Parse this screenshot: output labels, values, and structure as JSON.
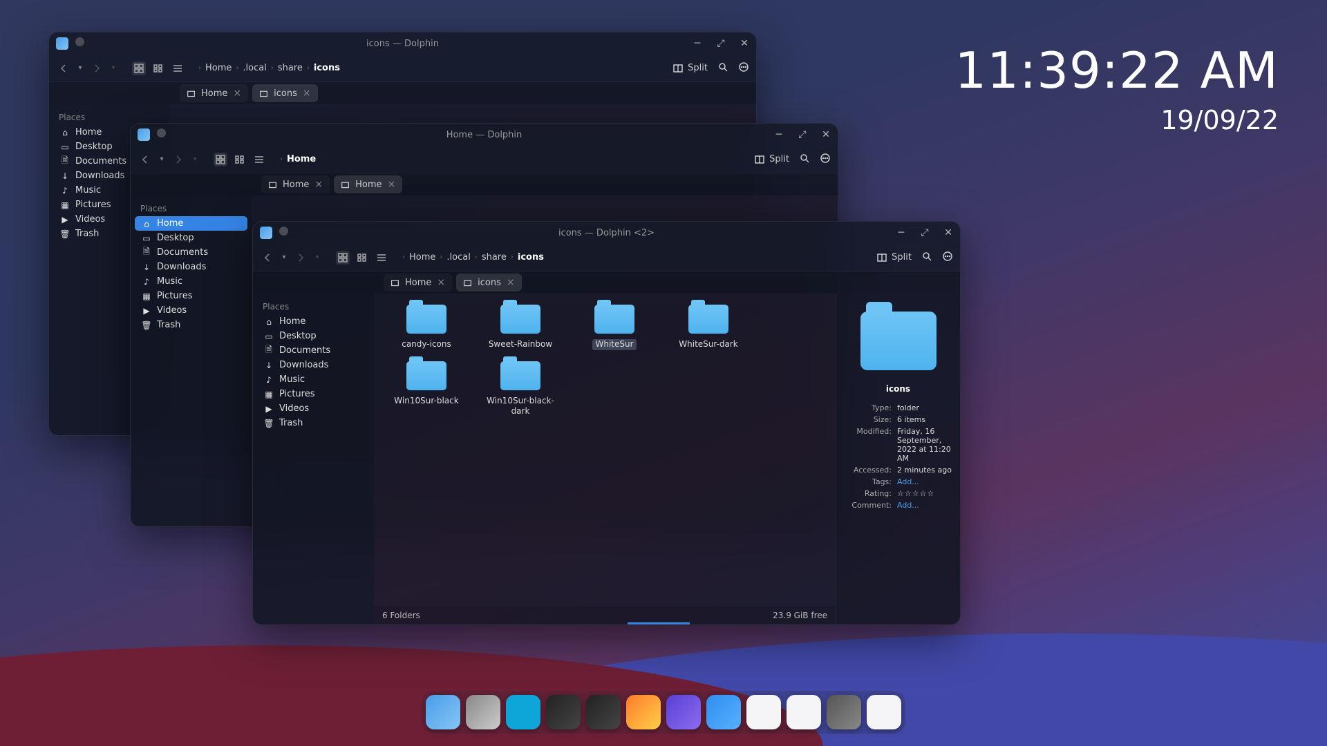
{
  "clock": {
    "time": "11:39:22 AM",
    "date": "19/09/22"
  },
  "windows": {
    "w1": {
      "title": "icons — Dolphin",
      "breadcrumb": [
        "Home",
        ".local",
        "share",
        "icons"
      ],
      "tabs": [
        {
          "label": "Home"
        },
        {
          "label": "icons"
        }
      ],
      "split": "Split"
    },
    "w2": {
      "title": "Home — Dolphin",
      "breadcrumb": [
        "Home"
      ],
      "tabs": [
        {
          "label": "Home"
        },
        {
          "label": "Home"
        }
      ],
      "split": "Split"
    },
    "w3": {
      "title": "icons — Dolphin <2>",
      "breadcrumb": [
        "Home",
        ".local",
        "share",
        "icons"
      ],
      "tabs": [
        {
          "label": "Home"
        },
        {
          "label": "icons"
        }
      ],
      "split": "Split",
      "status_left": "6 Folders",
      "status_right": "23.9 GiB free"
    }
  },
  "places_header": "Places",
  "places": [
    {
      "icon": "home",
      "label": "Home"
    },
    {
      "icon": "desktop",
      "label": "Desktop"
    },
    {
      "icon": "documents",
      "label": "Documents"
    },
    {
      "icon": "downloads",
      "label": "Downloads"
    },
    {
      "icon": "music",
      "label": "Music"
    },
    {
      "icon": "pictures",
      "label": "Pictures"
    },
    {
      "icon": "videos",
      "label": "Videos"
    },
    {
      "icon": "trash",
      "label": "Trash"
    }
  ],
  "folders": [
    "candy-icons",
    "Sweet-Rainbow",
    "WhiteSur",
    "WhiteSur-dark",
    "Win10Sur-black",
    "Win10Sur-black-dark"
  ],
  "info": {
    "name": "icons",
    "type_k": "Type:",
    "type_v": "folder",
    "size_k": "Size:",
    "size_v": "6 items",
    "mod_k": "Modified:",
    "mod_v": "Friday, 16 September, 2022 at 11:20 AM",
    "acc_k": "Accessed:",
    "acc_v": "2 minutes ago",
    "tags_k": "Tags:",
    "tags_v": "Add...",
    "rating_k": "Rating:",
    "rating_v": "☆☆☆☆☆",
    "comment_k": "Comment:",
    "comment_v": "Add..."
  },
  "dock": [
    {
      "name": "finder",
      "bg": "linear-gradient(135deg,#4a9de8,#85c5f5)"
    },
    {
      "name": "settings",
      "bg": "linear-gradient(135deg,#888,#ccc)"
    },
    {
      "name": "media",
      "bg": "linear-gradient(135deg,#0ea5d9,#0ea5d9)"
    },
    {
      "name": "monitor",
      "bg": "linear-gradient(135deg,#222,#444)"
    },
    {
      "name": "terminal",
      "bg": "linear-gradient(135deg,#222,#444)"
    },
    {
      "name": "firefox",
      "bg": "linear-gradient(135deg,#ff7b29,#ffcf4a)"
    },
    {
      "name": "editor",
      "bg": "linear-gradient(135deg,#5a3fd4,#8b6cf0)"
    },
    {
      "name": "store",
      "bg": "linear-gradient(135deg,#2f8fef,#57b0ff)"
    },
    {
      "name": "music",
      "bg": "linear-gradient(135deg,#f5f5f7,#f5f5f7)"
    },
    {
      "name": "notes",
      "bg": "linear-gradient(135deg,#f5f5f7,#f5f5f7)"
    },
    {
      "name": "screenshot",
      "bg": "linear-gradient(135deg,#555,#888)"
    },
    {
      "name": "clock",
      "bg": "linear-gradient(135deg,#f5f5f7,#f5f5f7)"
    }
  ]
}
